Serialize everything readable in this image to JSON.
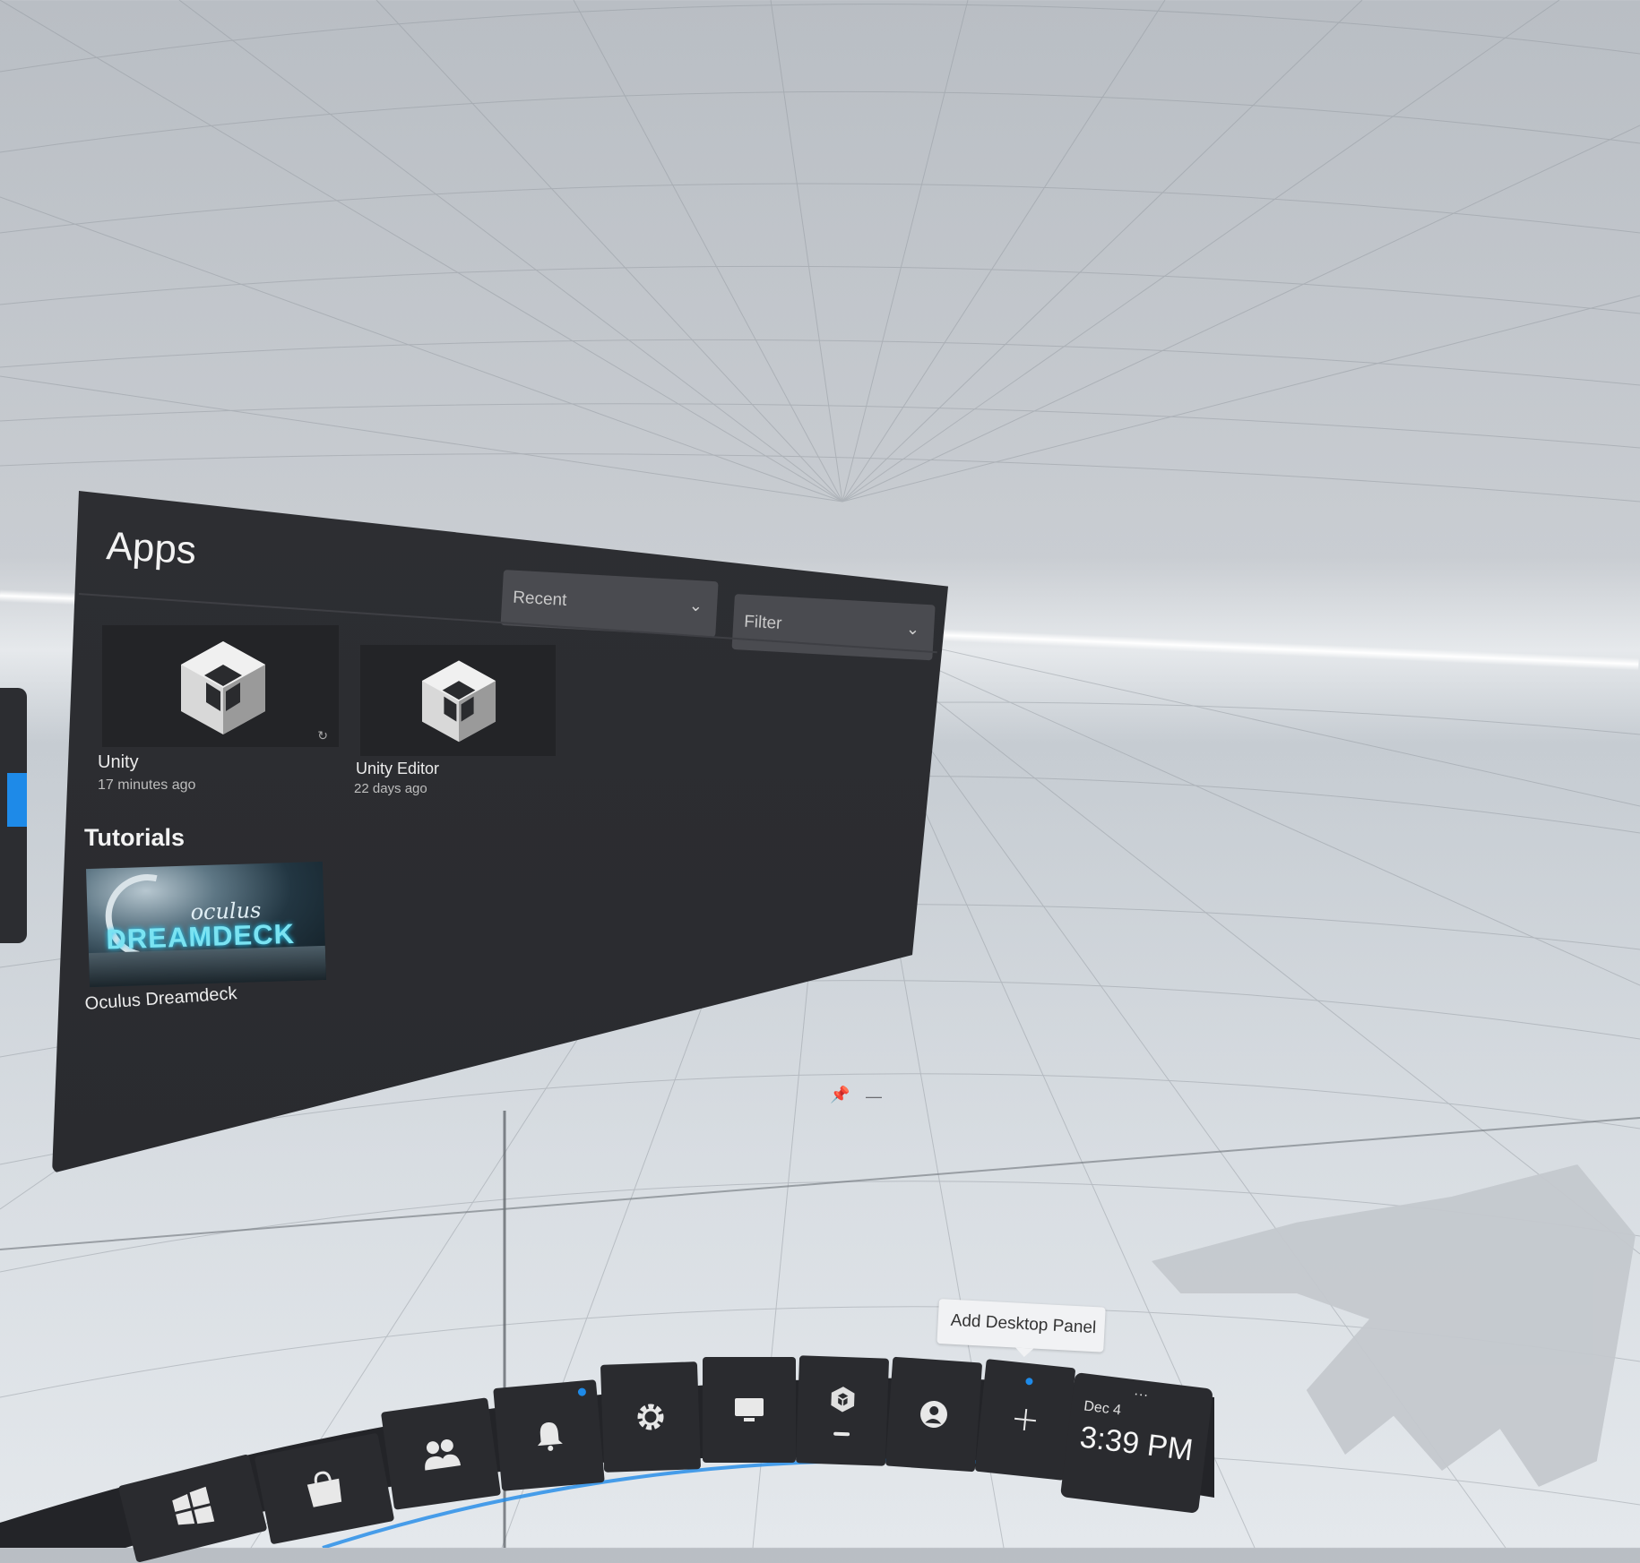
{
  "apps_panel": {
    "title": "Apps",
    "sort_dropdown": {
      "label": "Recent"
    },
    "filter_dropdown": {
      "label": "Filter"
    },
    "apps": [
      {
        "name": "Unity",
        "time": "17 minutes ago"
      },
      {
        "name": "Unity Editor",
        "time": "22 days ago"
      }
    ],
    "tutorials": {
      "heading": "Tutorials",
      "items": [
        {
          "name": "Oculus Dreamdeck",
          "thumb_line1": "oculus",
          "thumb_line2": "DREAMDECK"
        }
      ]
    }
  },
  "tooltip": {
    "text": "Add Desktop Panel"
  },
  "toolbar": {
    "buttons": [
      {
        "icon": "windows-icon"
      },
      {
        "icon": "store-bag-icon"
      },
      {
        "icon": "people-icon"
      },
      {
        "icon": "bell-icon",
        "badge_color": "#1e8ae8"
      },
      {
        "icon": "settings-gear-icon"
      },
      {
        "icon": "monitor-icon"
      },
      {
        "icon": "unity-cube-icon"
      },
      {
        "icon": "user-avatar-icon"
      },
      {
        "icon": "plus-icon"
      }
    ],
    "clock": {
      "date": "Dec 4",
      "time": "3:39 PM",
      "more": "..."
    }
  },
  "colors": {
    "accent": "#1e8ae8",
    "panel_bg": "#2b2c30",
    "environment": "#d8dde2"
  }
}
